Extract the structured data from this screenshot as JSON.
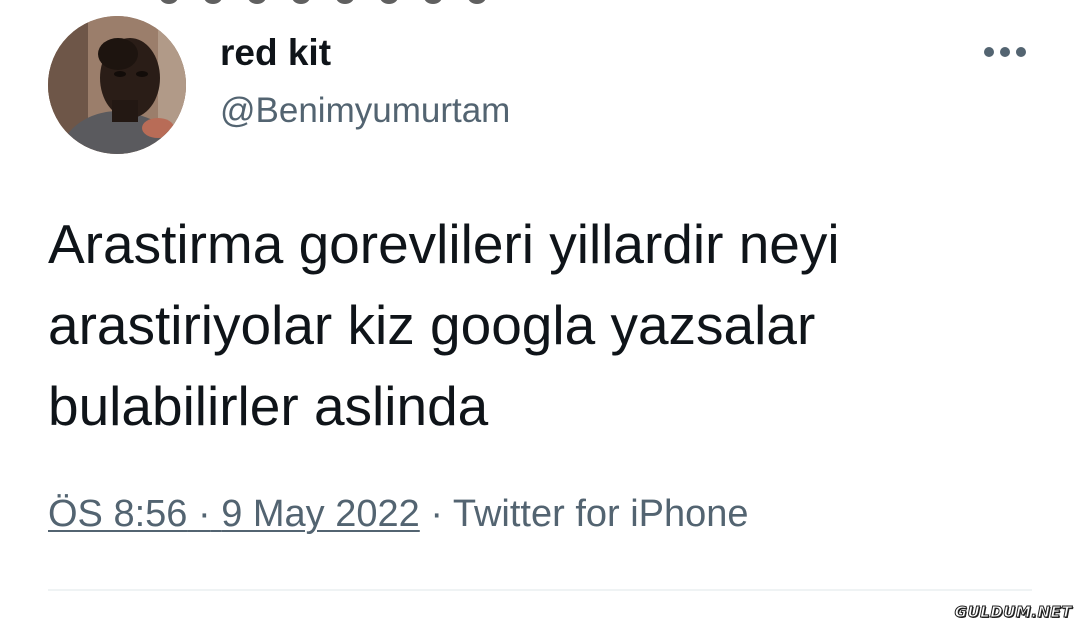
{
  "tweet": {
    "author": {
      "display_name": "red kit",
      "handle": "@Benimyumurtam"
    },
    "text_lines": [
      "Arastirma gorevlileri yillardir neyi",
      "arastiriyolar kiz googla yazsalar",
      "bulabilirler aslinda"
    ],
    "time": "ÖS 8:56",
    "dot": "·",
    "date": "9 May 2022",
    "source": "Twitter for iPhone"
  },
  "icons": {
    "more": "more-horizontal-icon"
  },
  "watermark": "GULDUM.NET",
  "colors": {
    "text_primary": "#0f1419",
    "text_secondary": "#536471",
    "separator": "#eff3f4",
    "background": "#ffffff"
  }
}
